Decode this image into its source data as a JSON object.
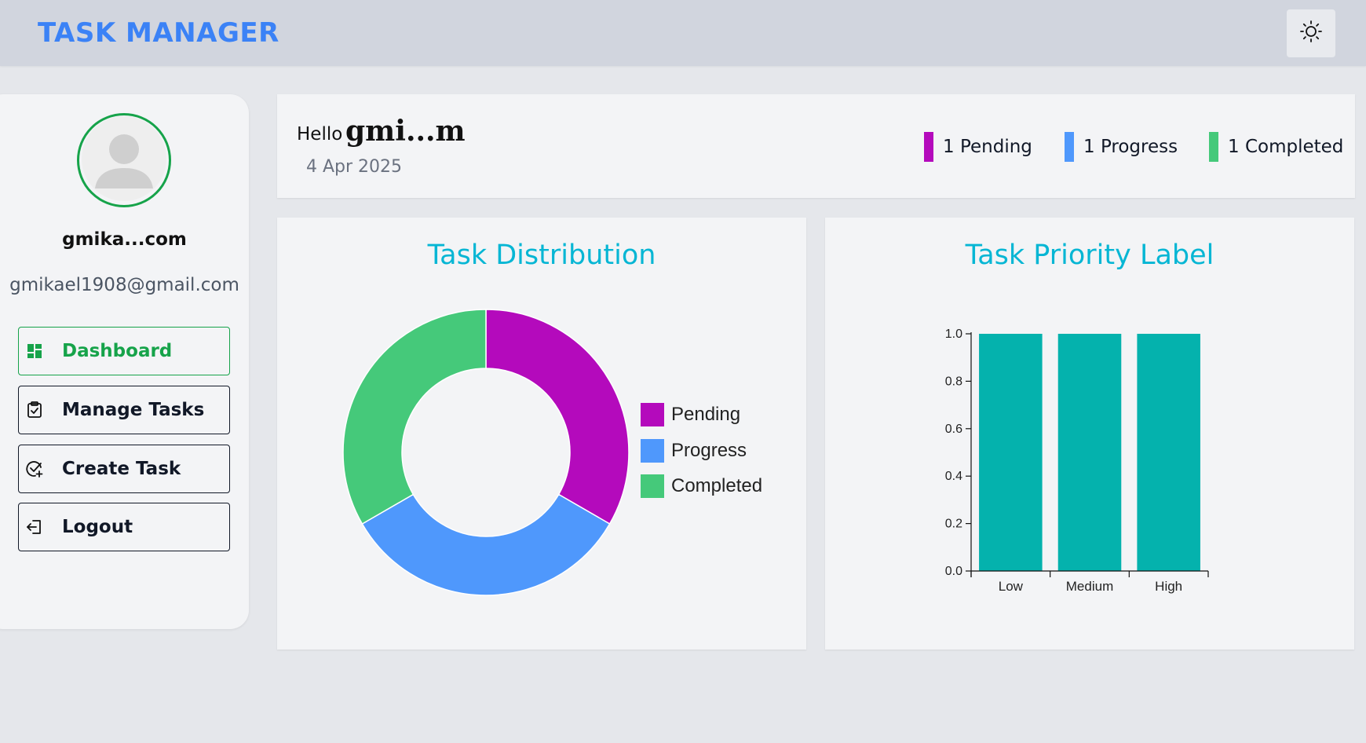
{
  "header": {
    "brand": "TASK MANAGER",
    "theme_toggle_icon": "sun-icon"
  },
  "sidebar": {
    "user_name": "gmika...com",
    "user_email": "gmikael1908@gmail.com",
    "avatar_icon": "user-avatar-icon",
    "items": [
      {
        "label": "Dashboard",
        "icon": "dashboard-icon",
        "active": true
      },
      {
        "label": "Manage Tasks",
        "icon": "clipboard-check-icon",
        "active": false
      },
      {
        "label": "Create Task",
        "icon": "circle-check-plus-icon",
        "active": false
      },
      {
        "label": "Logout",
        "icon": "logout-icon",
        "active": false
      }
    ]
  },
  "greeting": {
    "hello": "Hello",
    "name": "gmi...m",
    "date": "4 Apr 2025",
    "stats": [
      {
        "label": "1 Pending",
        "color": "#b40abc"
      },
      {
        "label": "1 Progress",
        "color": "#4f98fc"
      },
      {
        "label": "1 Completed",
        "color": "#45c97a"
      }
    ]
  },
  "colors": {
    "accent": "#3b82f6",
    "title": "#06b6d4",
    "active_nav": "#16a34a",
    "bar": "#04b2ad"
  },
  "chart_data": [
    {
      "type": "pie",
      "title": "Task Distribution",
      "categories": [
        "Pending",
        "Progress",
        "Completed"
      ],
      "values": [
        1,
        1,
        1
      ],
      "colors": [
        "#b40abc",
        "#4f98fc",
        "#45c97a"
      ],
      "legend": "right"
    },
    {
      "type": "bar",
      "title": "Task Priority Label",
      "categories": [
        "Low",
        "Medium",
        "High"
      ],
      "values": [
        1,
        1,
        1
      ],
      "ylim": [
        0,
        1
      ],
      "yticks": [
        "0.0",
        "0.2",
        "0.4",
        "0.6",
        "0.8",
        "1.0"
      ],
      "color": "#04b2ad",
      "grid": false
    }
  ]
}
